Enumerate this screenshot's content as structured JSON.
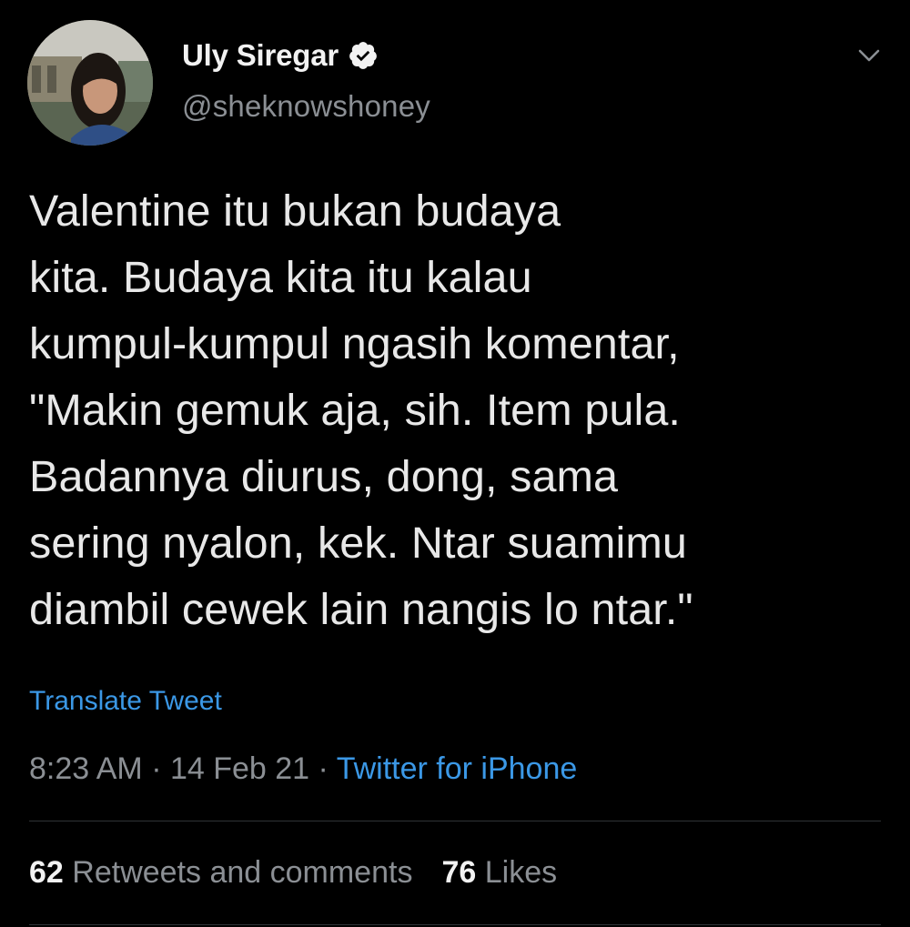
{
  "user": {
    "display_name": "Uly Siregar",
    "handle": "@sheknowshoney",
    "verified": true
  },
  "tweet": {
    "text": "Valentine itu bukan budaya\nkita. Budaya kita itu kalau\nkumpul-kumpul ngasih komentar,\n\"Makin gemuk aja, sih. Item pula.\nBadannya diurus, dong, sama\nsering nyalon, kek. Ntar suamimu\ndiambil cewek lain nangis lo ntar.\"",
    "translate_label": "Translate Tweet"
  },
  "meta": {
    "time": "8:23 AM",
    "separator": " · ",
    "date": "14 Feb 21",
    "source": "Twitter for iPhone"
  },
  "stats": {
    "retweets_count": "62",
    "retweets_label": "Retweets and comments",
    "likes_count": "76",
    "likes_label": "Likes"
  },
  "icons": {
    "verified": "verified-badge-icon",
    "menu": "chevron-down-icon"
  },
  "colors": {
    "background": "#000000",
    "link": "#3b98e6",
    "secondary_text": "#8b8f94",
    "primary_text": "#e8e8e8"
  }
}
